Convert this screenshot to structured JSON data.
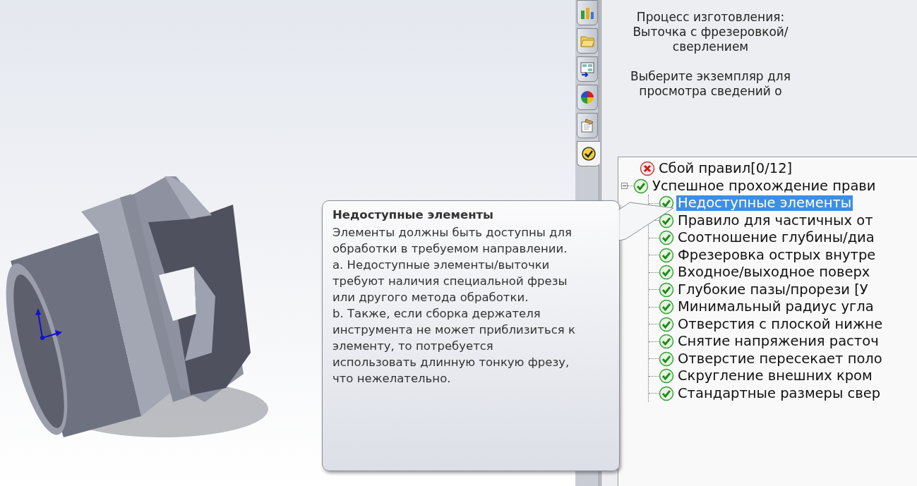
{
  "tabs": [
    {
      "selected": false
    },
    {
      "selected": false
    },
    {
      "selected": false
    },
    {
      "selected": false
    },
    {
      "selected": false
    },
    {
      "selected": true
    }
  ],
  "info": {
    "process": "Процесс изготовления: Выточка с фрезеровкой/сверлением",
    "hint": "Выберите экземпляр для просмотра сведений о"
  },
  "tree": [
    {
      "kind": "fail",
      "label": "Сбой правил[0/12]",
      "selected": false
    },
    {
      "kind": "pass",
      "label": "Успешное прохождение прави",
      "selected": false,
      "expanded": true,
      "children": [
        {
          "kind": "pass",
          "label": "Недоступные элементы",
          "selected": true
        },
        {
          "kind": "pass",
          "label": "Правило для частичных от",
          "selected": false
        },
        {
          "kind": "pass",
          "label": "Соотношение глубины/диа",
          "selected": false
        },
        {
          "kind": "pass",
          "label": "Фрезеровка острых внутре",
          "selected": false
        },
        {
          "kind": "pass",
          "label": "Входное/выходное поверх",
          "selected": false
        },
        {
          "kind": "pass",
          "label": "Глубокие пазы/прорези [У",
          "selected": false
        },
        {
          "kind": "pass",
          "label": "Минимальный радиус угла",
          "selected": false
        },
        {
          "kind": "pass",
          "label": "Отверстия с плоской нижне",
          "selected": false
        },
        {
          "kind": "pass",
          "label": "Снятие напряжения расточ",
          "selected": false
        },
        {
          "kind": "pass",
          "label": "Отверстие пересекает поло",
          "selected": false
        },
        {
          "kind": "pass",
          "label": "Скругление внешних кром",
          "selected": false
        },
        {
          "kind": "pass",
          "label": "Стандартные размеры свер",
          "selected": false
        }
      ]
    }
  ],
  "tooltip": {
    "title": "Недоступные элементы",
    "paragraphs": [
      "Элементы должны быть доступны для обработки в требуемом направлении.",
      "a. Недоступные элементы/выточки требуют наличия специальной фрезы или другого метода обработки.",
      "b. Также, если сборка держателя инструмента не может приблизиться к элементу, то потребуется использовать длинную тонкую фрезу, что нежелательно."
    ]
  }
}
